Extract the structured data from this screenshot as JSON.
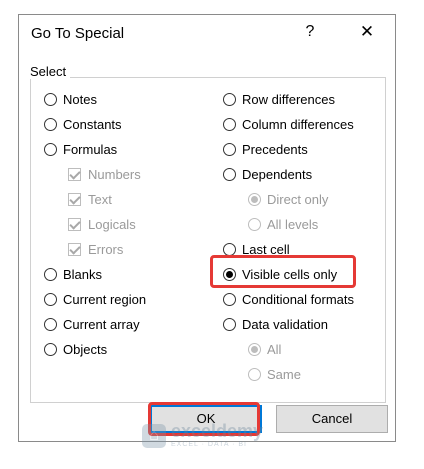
{
  "dialog": {
    "title": "Go To Special",
    "help_glyph": "?",
    "close_glyph": "✕"
  },
  "select_group": {
    "label": "Select",
    "left_options": [
      {
        "label": "Notes",
        "checked": false
      },
      {
        "label": "Constants",
        "checked": false
      },
      {
        "label": "Formulas",
        "checked": false
      },
      {
        "label": "Blanks",
        "checked": false
      },
      {
        "label": "Current region",
        "checked": false
      },
      {
        "label": "Current array",
        "checked": false
      },
      {
        "label": "Objects",
        "checked": false
      }
    ],
    "formula_subtypes": [
      {
        "label": "Numbers",
        "checked": true
      },
      {
        "label": "Text",
        "checked": true
      },
      {
        "label": "Logicals",
        "checked": true
      },
      {
        "label": "Errors",
        "checked": true
      }
    ],
    "right_options": [
      {
        "label": "Row differences",
        "checked": false
      },
      {
        "label": "Column differences",
        "checked": false
      },
      {
        "label": "Precedents",
        "checked": false
      },
      {
        "label": "Dependents",
        "checked": false
      },
      {
        "label": "Last cell",
        "checked": false
      },
      {
        "label": "Visible cells only",
        "checked": true
      },
      {
        "label": "Conditional formats",
        "checked": false
      },
      {
        "label": "Data validation",
        "checked": false
      }
    ],
    "dependents_subtypes": [
      {
        "label": "Direct only",
        "checked": true
      },
      {
        "label": "All levels",
        "checked": false
      }
    ],
    "validation_subtypes": [
      {
        "label": "All",
        "checked": true
      },
      {
        "label": "Same",
        "checked": false
      }
    ]
  },
  "buttons": {
    "ok": "OK",
    "cancel": "Cancel"
  },
  "watermark": {
    "name": "exceldemy",
    "tagline": "EXCEL · DATA · BI"
  },
  "colors": {
    "highlight": "#e53935",
    "default_button_border": "#0078d7"
  }
}
